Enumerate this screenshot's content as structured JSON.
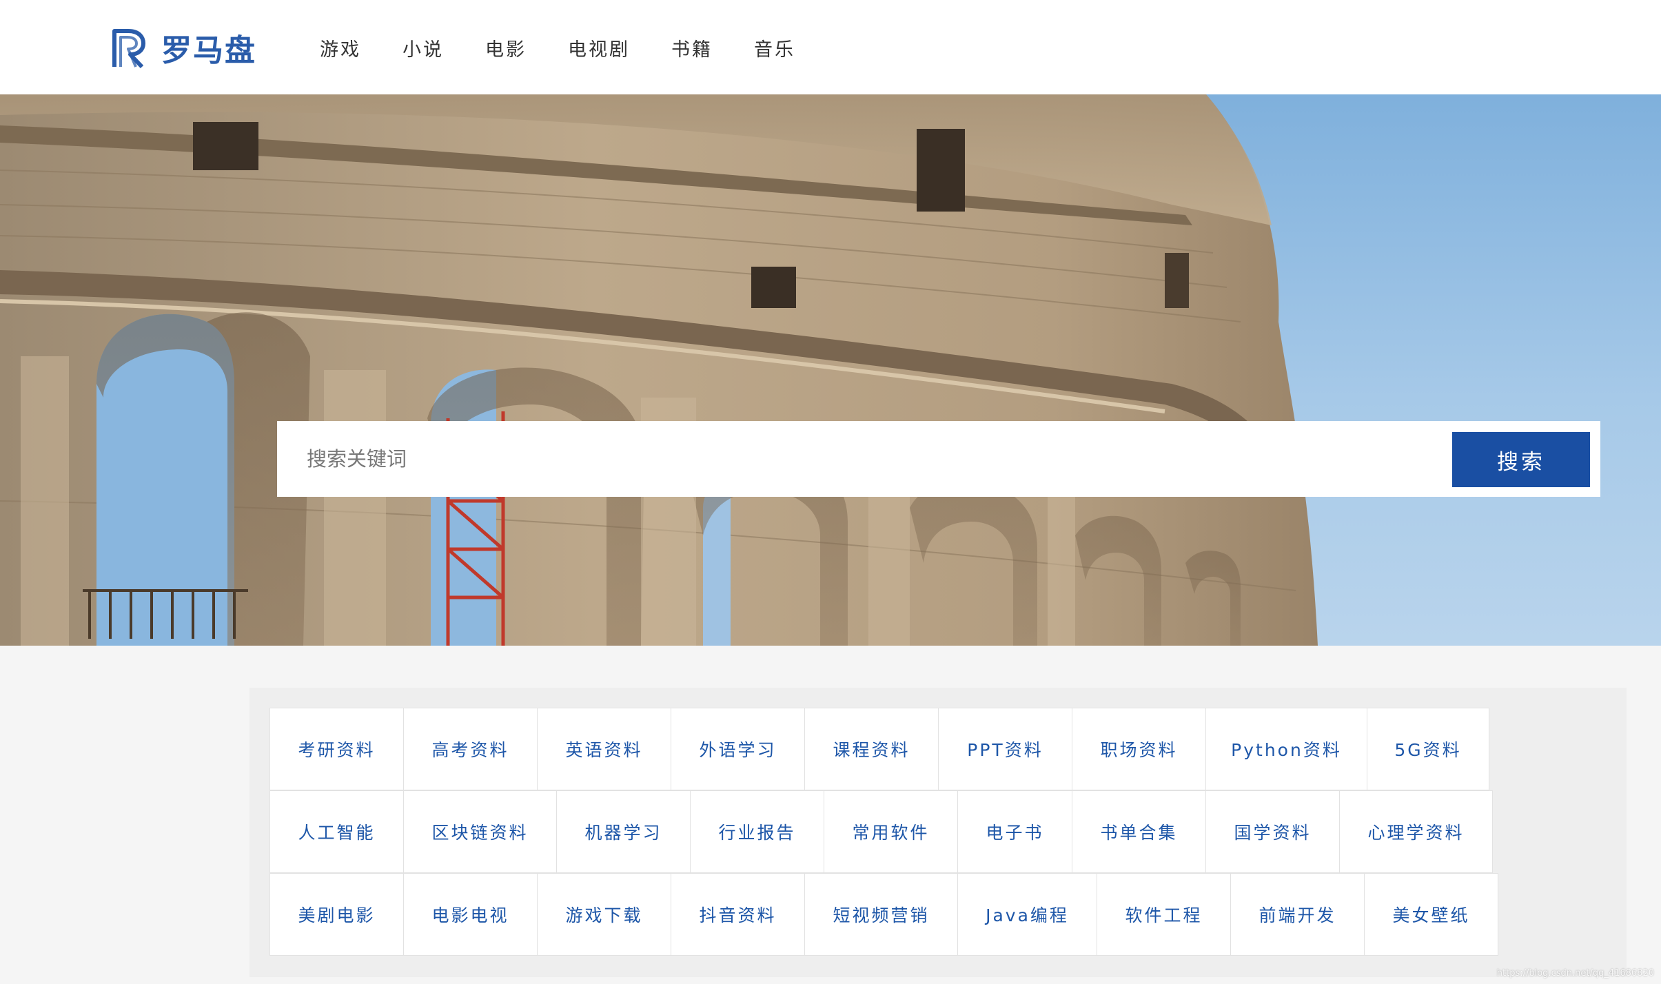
{
  "brand": {
    "name": "罗马盘",
    "color": "#2a5caa",
    "logo_icon": "r-logo-icon"
  },
  "nav": {
    "items": [
      {
        "label": "游戏"
      },
      {
        "label": "小说"
      },
      {
        "label": "电影"
      },
      {
        "label": "电视剧"
      },
      {
        "label": "书籍"
      },
      {
        "label": "音乐"
      }
    ]
  },
  "hero": {
    "image": "colosseum-photo"
  },
  "search": {
    "placeholder": "搜索关键词",
    "value": "",
    "button_label": "搜索",
    "button_color": "#1a4fa3"
  },
  "categories": {
    "link_color": "#1d56a8",
    "rows": [
      [
        {
          "label": "考研资料"
        },
        {
          "label": "高考资料"
        },
        {
          "label": "英语资料"
        },
        {
          "label": "外语学习"
        },
        {
          "label": "课程资料"
        },
        {
          "label": "PPT资料"
        },
        {
          "label": "职场资料"
        },
        {
          "label": "Python资料"
        },
        {
          "label": "5G资料"
        }
      ],
      [
        {
          "label": "人工智能"
        },
        {
          "label": "区块链资料"
        },
        {
          "label": "机器学习"
        },
        {
          "label": "行业报告"
        },
        {
          "label": "常用软件"
        },
        {
          "label": "电子书"
        },
        {
          "label": "书单合集"
        },
        {
          "label": "国学资料"
        },
        {
          "label": "心理学资料"
        }
      ],
      [
        {
          "label": "美剧电影"
        },
        {
          "label": "电影电视"
        },
        {
          "label": "游戏下载"
        },
        {
          "label": "抖音资料"
        },
        {
          "label": "短视频营销"
        },
        {
          "label": "Java编程"
        },
        {
          "label": "软件工程"
        },
        {
          "label": "前端开发"
        },
        {
          "label": "美女壁纸"
        }
      ]
    ]
  },
  "watermark": "https://blog.csdn.net/qq_41686820"
}
